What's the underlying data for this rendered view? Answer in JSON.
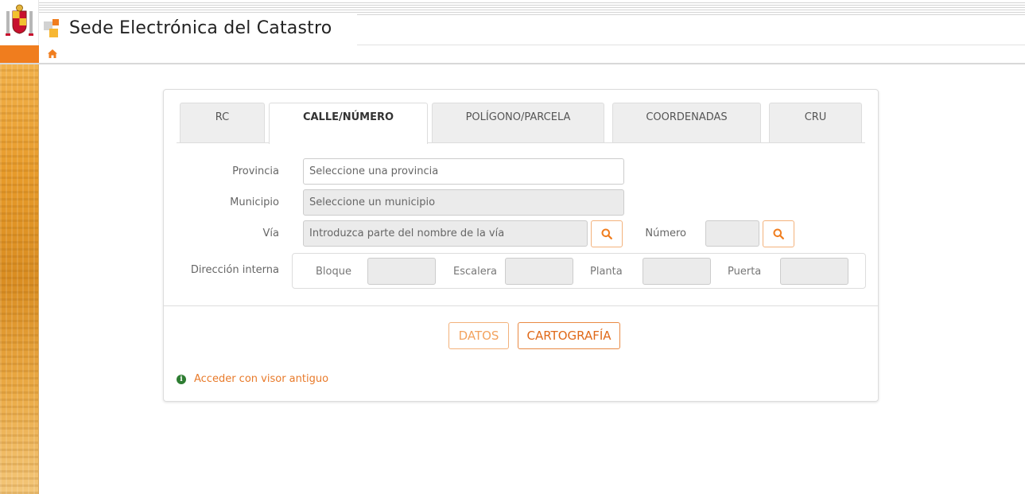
{
  "header": {
    "title": "Sede Electrónica del Catastro",
    "logo_colors": {
      "orange": "#f07d1e",
      "yellow": "#f7b733",
      "gray": "#cfcfcf"
    }
  },
  "nav": {
    "home_icon": "home-icon"
  },
  "tabs": [
    {
      "label": "RC",
      "active": false
    },
    {
      "label": "CALLE/NÚMERO",
      "active": true
    },
    {
      "label": "POLÍGONO/PARCELA",
      "active": false
    },
    {
      "label": "COORDENADAS",
      "active": false
    },
    {
      "label": "CRU",
      "active": false
    }
  ],
  "form": {
    "provincia": {
      "label": "Provincia",
      "placeholder": "Seleccione una provincia"
    },
    "municipio": {
      "label": "Municipio",
      "placeholder": "Seleccione un municipio"
    },
    "via": {
      "label": "Vía",
      "placeholder": "Introduzca parte del nombre de la vía"
    },
    "numero": {
      "label": "Número"
    },
    "direccion_interna": {
      "label": "Dirección interna",
      "bloque": "Bloque",
      "escalera": "Escalera",
      "planta": "Planta",
      "puerta": "Puerta"
    }
  },
  "actions": {
    "datos": "DATOS",
    "cartografia": "CARTOGRAFÍA"
  },
  "old_viewer": {
    "icon": "info-icon",
    "label": "Acceder con visor antiguo"
  },
  "colors": {
    "accent": "#f07d1e",
    "link": "#e87a2a",
    "info": "#2e7d32"
  }
}
